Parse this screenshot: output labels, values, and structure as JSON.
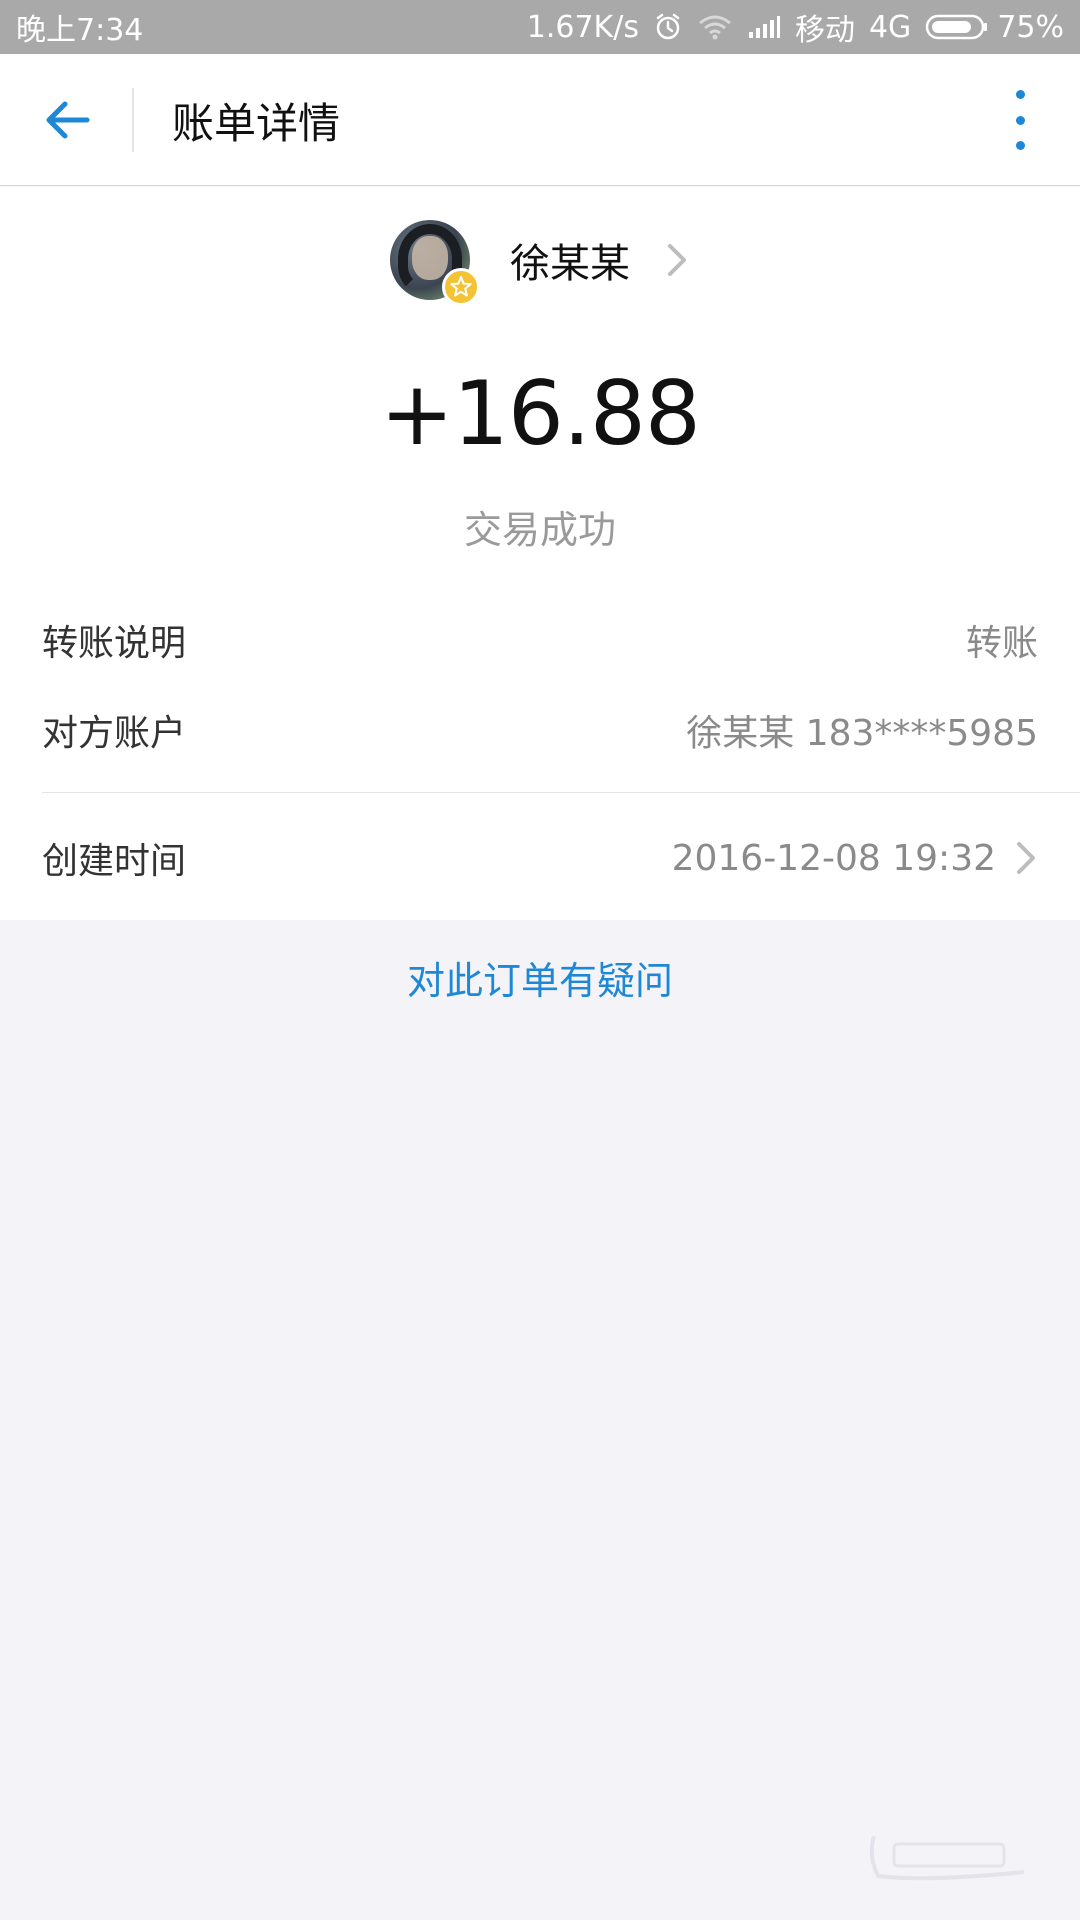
{
  "statusbar": {
    "time": "晚上7:34",
    "speed": "1.67K/s",
    "carrier": "移动",
    "network": "4G",
    "battery": "75%",
    "icons": [
      "alarm-icon",
      "wifi-icon",
      "signal-icon",
      "battery-icon"
    ]
  },
  "appbar": {
    "title": "账单详情",
    "back_icon": "arrow-left-icon",
    "more_icon": "more-vertical-icon",
    "accent": "#1e88d6"
  },
  "person": {
    "name": "徐某某",
    "badge_icon": "star-icon",
    "badge_color": "#f4c333"
  },
  "transaction": {
    "amount": "+16.88",
    "status": "交易成功"
  },
  "details": [
    {
      "label": "转账说明",
      "value": "转账"
    },
    {
      "label": "对方账户",
      "value": "徐某某 183****5985"
    },
    {
      "label": "创建时间",
      "value": "2016-12-08 19:32"
    }
  ],
  "question_link": "对此订单有疑问"
}
